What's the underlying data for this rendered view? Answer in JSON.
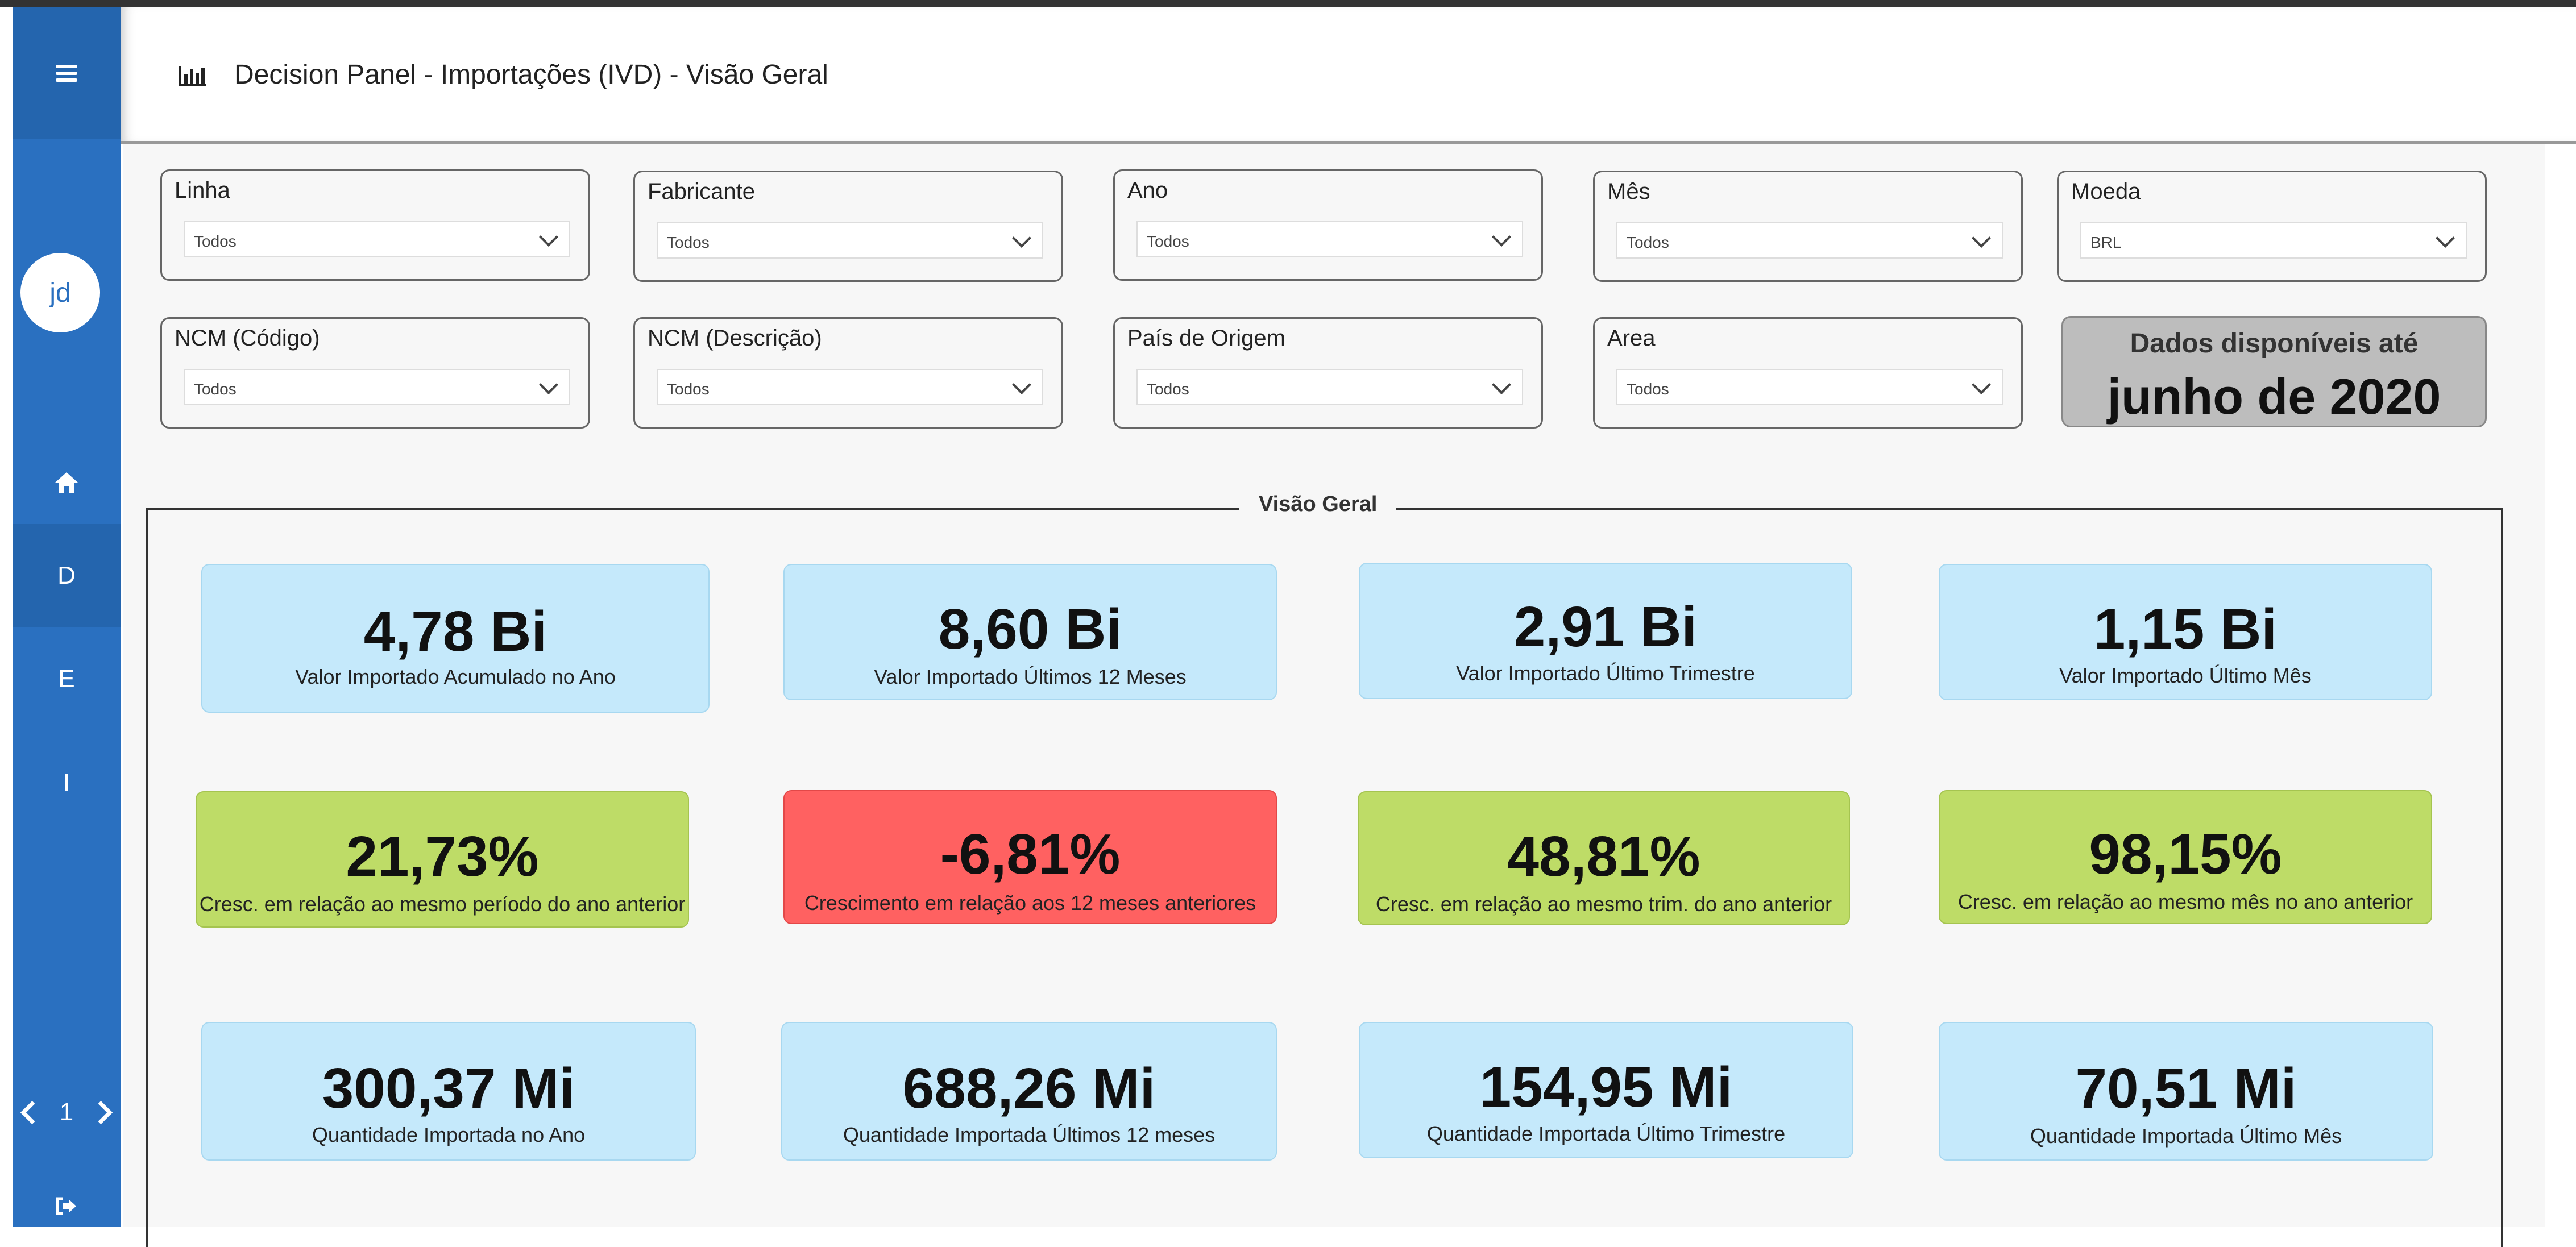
{
  "sidebar": {
    "avatar": "jd",
    "items": [
      {
        "label": "D",
        "active": true
      },
      {
        "label": "E",
        "active": false
      },
      {
        "label": "I",
        "active": false
      }
    ],
    "pager": {
      "page": "1"
    }
  },
  "header": {
    "title": "Decision Panel - Importações (IVD) - Visão Geral"
  },
  "filters": [
    {
      "label": "Linha",
      "value": "Todos"
    },
    {
      "label": "Fabricante",
      "value": "Todos"
    },
    {
      "label": "Ano",
      "value": "Todos"
    },
    {
      "label": "Mês",
      "value": "Todos"
    },
    {
      "label": "Moeda",
      "value": "BRL"
    },
    {
      "label": "NCM (Código)",
      "value": "Todos"
    },
    {
      "label": "NCM (Descrição)",
      "value": "Todos"
    },
    {
      "label": "País de Origem",
      "value": "Todos"
    },
    {
      "label": "Area",
      "value": "Todos"
    }
  ],
  "availability": {
    "title": "Dados disponíveis até",
    "date": "junho de 2020"
  },
  "section": {
    "title": "Visão Geral"
  },
  "kpis": [
    {
      "value": "4,78 Bi",
      "label": "Valor Importado Acumulado no Ano"
    },
    {
      "value": "8,60 Bi",
      "label": "Valor Importado Últimos 12 Meses"
    },
    {
      "value": "2,91 Bi",
      "label": "Valor Importado Último Trimestre"
    },
    {
      "value": "1,15 Bi",
      "label": "Valor Importado Último Mês"
    },
    {
      "value": "21,73%",
      "label": "Cresc. em relação ao mesmo período do ano anterior"
    },
    {
      "value": "-6,81%",
      "label": "Crescimento em relação aos 12 meses anteriores"
    },
    {
      "value": "48,81%",
      "label": "Cresc. em relação ao mesmo trim. do ano anterior"
    },
    {
      "value": "98,15%",
      "label": "Cresc. em relação ao mesmo mês no ano anterior"
    },
    {
      "value": "300,37 Mi",
      "label": "Quantidade Importada no Ano"
    },
    {
      "value": "688,26 Mi",
      "label": "Quantidade Importada Últimos 12 meses"
    },
    {
      "value": "154,95 Mi",
      "label": "Quantidade Importada Último Trimestre"
    },
    {
      "value": "70,51 Mi",
      "label": "Quantidade Importada Último Mês"
    }
  ],
  "colors": {
    "sidebar": "#2a70c0",
    "kpi_blue": "#c5e9fb",
    "kpi_green": "#bedc67",
    "kpi_red": "#ff6161"
  }
}
